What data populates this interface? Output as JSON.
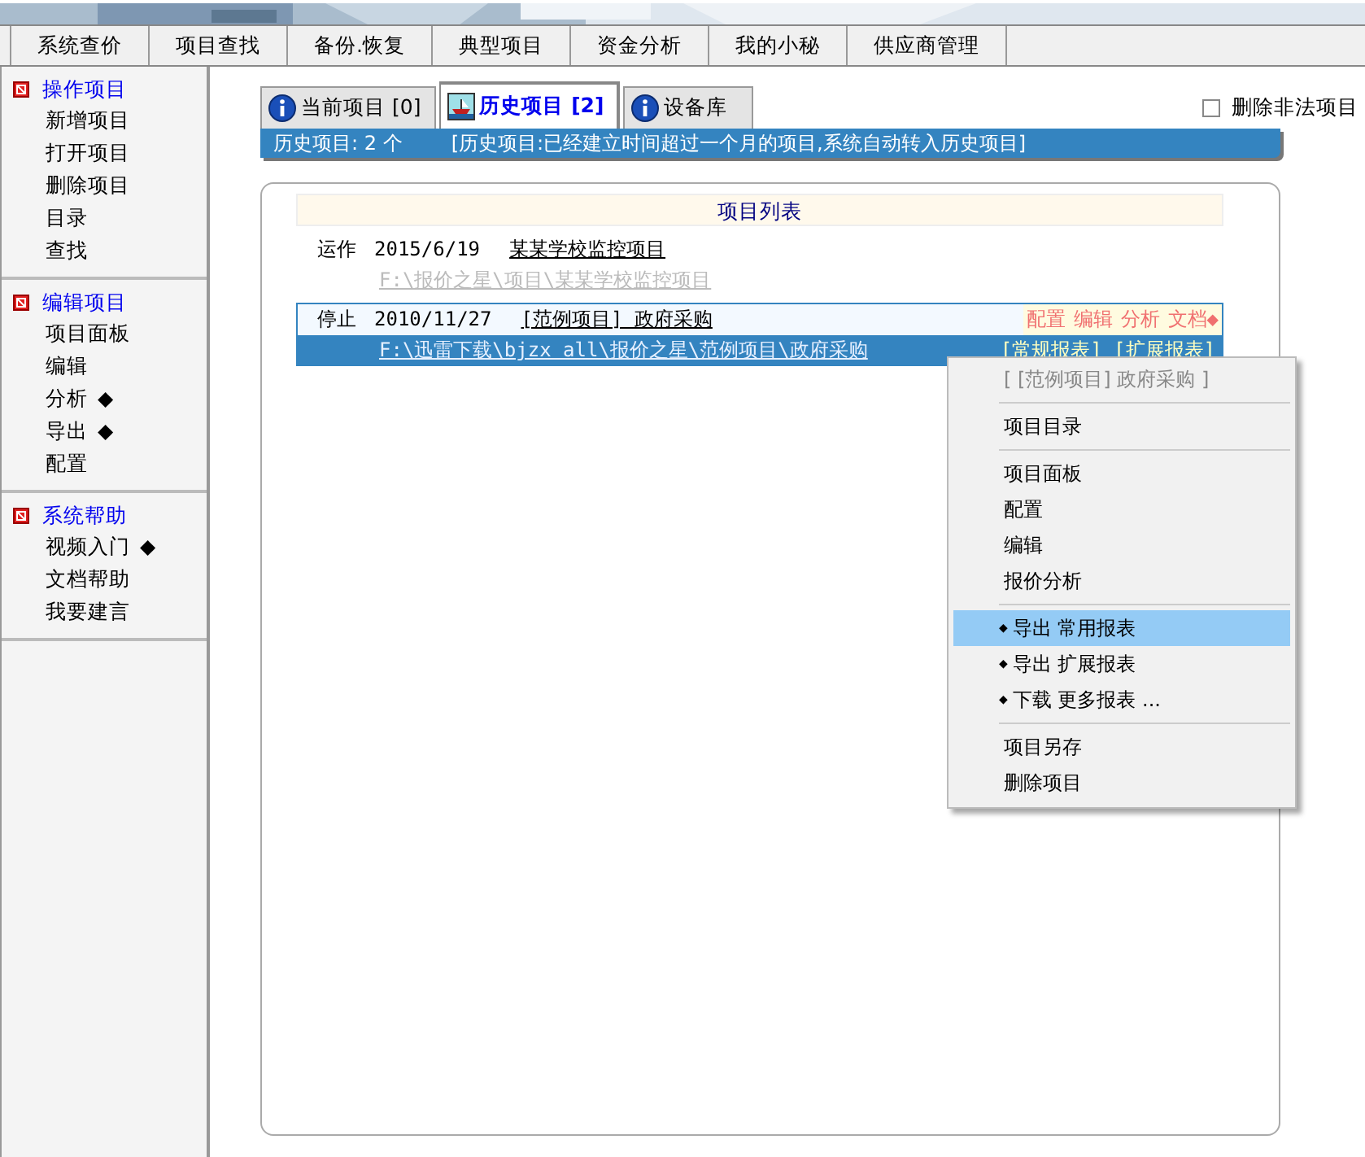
{
  "menubar": [
    {
      "label": "系统查价"
    },
    {
      "label": "项目查找"
    },
    {
      "label": "备份.恢复"
    },
    {
      "label": "典型项目"
    },
    {
      "label": "资金分析"
    },
    {
      "label": "我的小秘"
    },
    {
      "label": "供应商管理"
    }
  ],
  "sidebar": [
    {
      "title": "操作项目",
      "items": [
        {
          "label": "新增项目"
        },
        {
          "label": "打开项目"
        },
        {
          "label": "删除项目"
        },
        {
          "label": "目录"
        },
        {
          "label": "查找"
        }
      ]
    },
    {
      "title": "编辑项目",
      "items": [
        {
          "label": "项目面板"
        },
        {
          "label": "编辑"
        },
        {
          "label": "分析",
          "marker": "◆"
        },
        {
          "label": "导出",
          "marker": "◆"
        },
        {
          "label": "配置"
        }
      ]
    },
    {
      "title": "系统帮助",
      "items": [
        {
          "label": "视频入门",
          "marker": "◆"
        },
        {
          "label": "文档帮助"
        },
        {
          "label": "我要建言"
        }
      ]
    }
  ],
  "tabs": [
    {
      "label": "当前项目",
      "count": "[0]",
      "selected": false,
      "kind": "info"
    },
    {
      "label": "历史项目",
      "count": "[2]",
      "selected": true,
      "kind": "ship"
    },
    {
      "label": "设备库",
      "selected": false,
      "kind": "info"
    }
  ],
  "delete_illegal": {
    "label": "删除非法项目",
    "checked": false
  },
  "status_banner": {
    "count_text": "历史项目: 2 个",
    "note": "[历史项目:已经建立时间超过一个月的项目,系统自动转入历史项目]"
  },
  "project_list": {
    "title": "项目列表",
    "rows": [
      {
        "status": "运作",
        "date": "2015/6/19",
        "name": "某某学校监控项目",
        "path": "F:\\报价之星\\项目\\某某学校监控项目",
        "selected": false
      },
      {
        "status": "停止",
        "date": "2010/11/27",
        "name": "[范例项目] 政府采购",
        "path": "F:\\迅雷下载\\bjzx all\\报价之星\\范例项目\\政府采购",
        "selected": true,
        "actions": [
          "配置",
          "编辑",
          "分析",
          "文档◆"
        ],
        "reports": "[常规报表] [扩展报表]"
      }
    ]
  },
  "context_menu": {
    "header": "[ [范例项目] 政府采购 ]",
    "groups": [
      [
        {
          "label": "项目目录",
          "highlighted": false
        }
      ],
      [
        {
          "label": "项目面板",
          "highlighted": false
        },
        {
          "label": "配置",
          "highlighted": false
        },
        {
          "label": "编辑",
          "highlighted": false
        },
        {
          "label": "报价分析",
          "highlighted": false
        }
      ],
      [
        {
          "bullet": "◆",
          "label": "导出 常用报表",
          "highlighted": true
        },
        {
          "bullet": "◆",
          "label": "导出 扩展报表",
          "highlighted": false
        },
        {
          "bullet": "◆",
          "label": "下载 更多报表 ...",
          "highlighted": false
        }
      ],
      [
        {
          "label": "项目另存",
          "highlighted": false
        },
        {
          "label": "删除项目",
          "highlighted": false
        }
      ]
    ]
  }
}
